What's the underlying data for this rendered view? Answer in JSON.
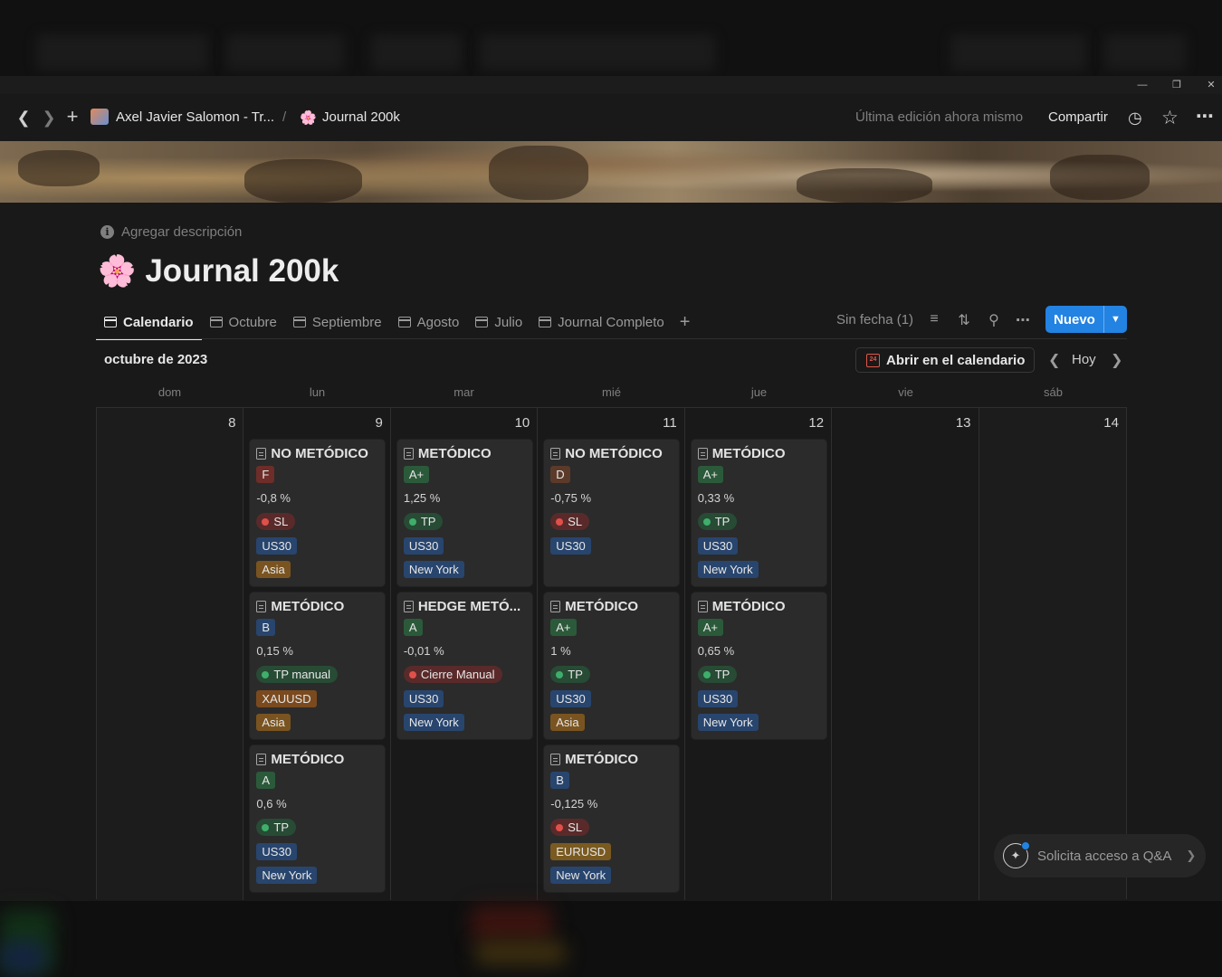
{
  "topbar": {
    "workspace": "Axel Javier Salomon - Tr...",
    "separator": "/",
    "page": "Journal 200k",
    "last_edit": "Última edición ahora mismo",
    "share": "Compartir"
  },
  "page": {
    "add_description": "Agregar descripción",
    "title": "Journal 200k",
    "flower_icon": "cherry-blossom-icon"
  },
  "tabs": [
    {
      "label": "Calendario",
      "active": true
    },
    {
      "label": "Octubre"
    },
    {
      "label": "Septiembre"
    },
    {
      "label": "Agosto"
    },
    {
      "label": "Julio"
    },
    {
      "label": "Journal Completo"
    }
  ],
  "toolbar": {
    "no_date": "Sin fecha (1)",
    "new_button": "Nuevo"
  },
  "calendar": {
    "month": "octubre de 2023",
    "open_in_calendar": "Abrir en el calendario",
    "today": "Hoy",
    "weekdays": [
      "dom",
      "lun",
      "mar",
      "mié",
      "jue",
      "vie",
      "sáb"
    ],
    "days": [
      {
        "num": "8",
        "entries": []
      },
      {
        "num": "9",
        "entries": [
          {
            "title": "NO METÓDICO",
            "grade": "F",
            "pct": "-0,8 %",
            "result": "SL",
            "symbol": "US30",
            "session": "Asia"
          },
          {
            "title": "METÓDICO",
            "grade": "B",
            "pct": "0,15 %",
            "result": "TP manual",
            "symbol": "XAUUSD",
            "session": "Asia"
          },
          {
            "title": "METÓDICO",
            "grade": "A",
            "pct": "0,6 %",
            "result": "TP",
            "symbol": "US30",
            "session": "New York"
          }
        ]
      },
      {
        "num": "10",
        "entries": [
          {
            "title": "METÓDICO",
            "grade": "A+",
            "pct": "1,25 %",
            "result": "TP",
            "symbol": "US30",
            "session": "New York"
          },
          {
            "title": "HEDGE METÓ...",
            "grade": "A",
            "pct": "-0,01 %",
            "result": "Cierre Manual",
            "symbol": "US30",
            "session": "New York"
          }
        ]
      },
      {
        "num": "11",
        "entries": [
          {
            "title": "NO METÓDICO",
            "grade": "D",
            "pct": "-0,75 %",
            "result": "SL",
            "symbol": "US30"
          },
          {
            "title": "METÓDICO",
            "grade": "A+",
            "pct": "1 %",
            "result": "TP",
            "symbol": "US30",
            "session": "Asia"
          },
          {
            "title": "METÓDICO",
            "grade": "B",
            "pct": "-0,125 %",
            "result": "SL",
            "symbol": "EURUSD",
            "session": "New York"
          }
        ]
      },
      {
        "num": "12",
        "entries": [
          {
            "title": "METÓDICO",
            "grade": "A+",
            "pct": "0,33 %",
            "result": "TP",
            "symbol": "US30",
            "session": "New York"
          },
          {
            "title": "METÓDICO",
            "grade": "A+",
            "pct": "0,65 %",
            "result": "TP",
            "symbol": "US30",
            "session": "New York"
          }
        ]
      },
      {
        "num": "13",
        "entries": []
      },
      {
        "num": "14",
        "entries": []
      }
    ]
  },
  "qa_button": "Solicita acceso a Q&A",
  "colors": {
    "accent": "#2383e2",
    "grade_green": "#2b5a3a",
    "grade_red": "#6e2d28",
    "grade_blue": "#28456e",
    "grade_brown": "#5c3a2a",
    "tp_pill": "#274b35",
    "sl_pill": "#5a2a2a",
    "symbol_blue": "#28456e",
    "session_orange": "#7a5420",
    "xauusd": "#7a4a1e",
    "eurusd": "#7a5a20"
  }
}
